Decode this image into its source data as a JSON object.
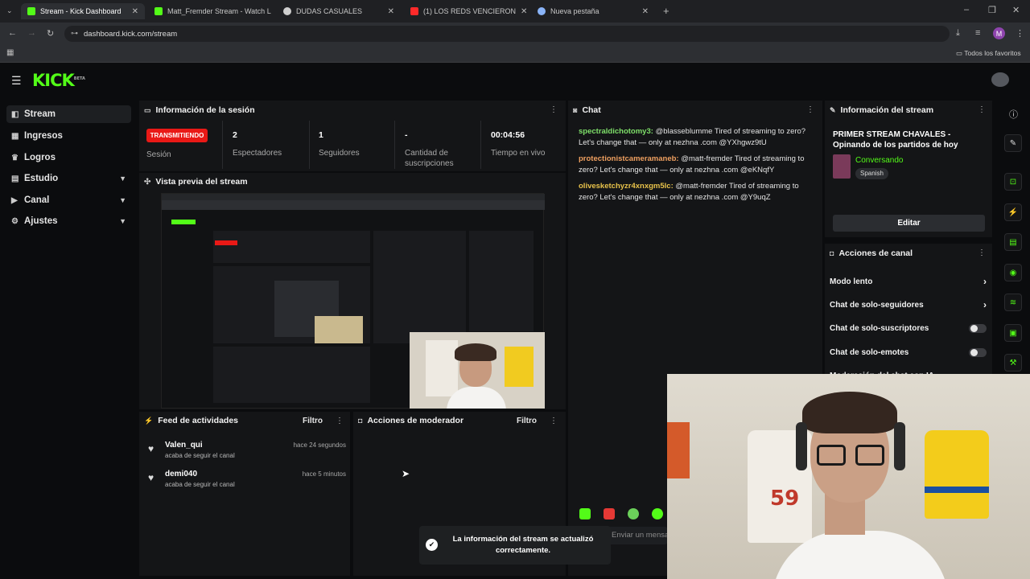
{
  "browser": {
    "tabs": [
      {
        "title": "Stream - Kick Dashboard",
        "fav": "#53fc18"
      },
      {
        "title": "Matt_Fremder Stream - Watch L",
        "fav": "#53fc18"
      },
      {
        "title": "DUDAS CASUALES",
        "fav": "#cfcfcf"
      },
      {
        "title": "(1) LOS REDS VENCIERON",
        "fav": "#ff2a2a"
      },
      {
        "title": "Nueva pestaña",
        "fav": "#8ab4f8"
      }
    ],
    "url": "dashboard.kick.com/stream",
    "bookmarks_label": "Todos los favoritos",
    "profile_initial": "M"
  },
  "app": {
    "logo": "KICK",
    "logo_badge": "BETA"
  },
  "sidebar": {
    "items": [
      {
        "label": "Stream",
        "icon": "stream-icon",
        "glyph": "◧",
        "chevron": false
      },
      {
        "label": "Ingresos",
        "icon": "money-icon",
        "glyph": "▦",
        "chevron": false
      },
      {
        "label": "Logros",
        "icon": "trophy-icon",
        "glyph": "♛",
        "chevron": false
      },
      {
        "label": "Estudio",
        "icon": "studio-icon",
        "glyph": "▤",
        "chevron": true
      },
      {
        "label": "Canal",
        "icon": "channel-icon",
        "glyph": "▶",
        "chevron": true
      },
      {
        "label": "Ajustes",
        "icon": "gear-icon",
        "glyph": "⚙",
        "chevron": true
      }
    ]
  },
  "session": {
    "title": "Información de la sesión",
    "status_badge": "TRANSMITIENDO",
    "status_color": "#e91916",
    "status_label": "Sesión",
    "stats": [
      {
        "value": "2",
        "label": "Espectadores"
      },
      {
        "value": "1",
        "label": "Seguidores"
      },
      {
        "value": "-",
        "label": "Cantidad de suscripciones"
      },
      {
        "value": "00:04:56",
        "label": "Tiempo en vivo"
      }
    ]
  },
  "preview": {
    "title": "Vista previa del stream"
  },
  "chat": {
    "title": "Chat",
    "messages": [
      {
        "user": "spectraldichotomy3:",
        "color": "#7fe06a",
        "text": "@blasseblumme Tired of streaming to zero? Let's change that — only at nezhna .com @YXhgwz9tU"
      },
      {
        "user": "protectionistcameramaneb:",
        "color": "#f0a060",
        "text": "@matt-fremder Tired of streaming to zero? Let's change that — only at nezhna .com @eKNqfY"
      },
      {
        "user": "olivesketchyzr4xnxgm5lc:",
        "color": "#e8c24a",
        "text": "@matt-fremder Tired of streaming to zero? Let's change that — only at nezhna .com @Y9uqZ"
      }
    ],
    "input_placeholder": "Enviar un mensaje"
  },
  "stream_info": {
    "title": "Información del stream",
    "stream_title": "PRIMER STREAM CHAVALES - Opinando de los partidos de hoy",
    "category": "Conversando",
    "language": "Spanish",
    "edit_label": "Editar"
  },
  "channel_actions": {
    "title": "Acciones de canal",
    "rows": [
      {
        "label": "Modo lento",
        "control": "chevron"
      },
      {
        "label": "Chat de solo-seguidores",
        "control": "chevron"
      },
      {
        "label": "Chat de solo-suscriptores",
        "control": "toggle"
      },
      {
        "label": "Chat de solo-emotes",
        "control": "toggle"
      }
    ],
    "cut_row": "Moderación del chat con IA"
  },
  "feed": {
    "title": "Feed de actividades",
    "filter": "Filtro",
    "items": [
      {
        "name": "Valen_qui",
        "sub": "acaba de seguir el canal",
        "time": "hace 24 segundos"
      },
      {
        "name": "demi040",
        "sub": "acaba de seguir el canal",
        "time": "hace 5 minutos"
      }
    ]
  },
  "moderator": {
    "title": "Acciones de moderador",
    "filter": "Filtro"
  },
  "toast": {
    "text": "La información del stream se actualizó correctamente."
  },
  "right_rail": [
    "edit-icon",
    "screenshot-icon",
    "bolt-icon",
    "document-icon",
    "chat-bubble-icon",
    "broadcast-icon",
    "layout-icon",
    "wrench-icon"
  ]
}
